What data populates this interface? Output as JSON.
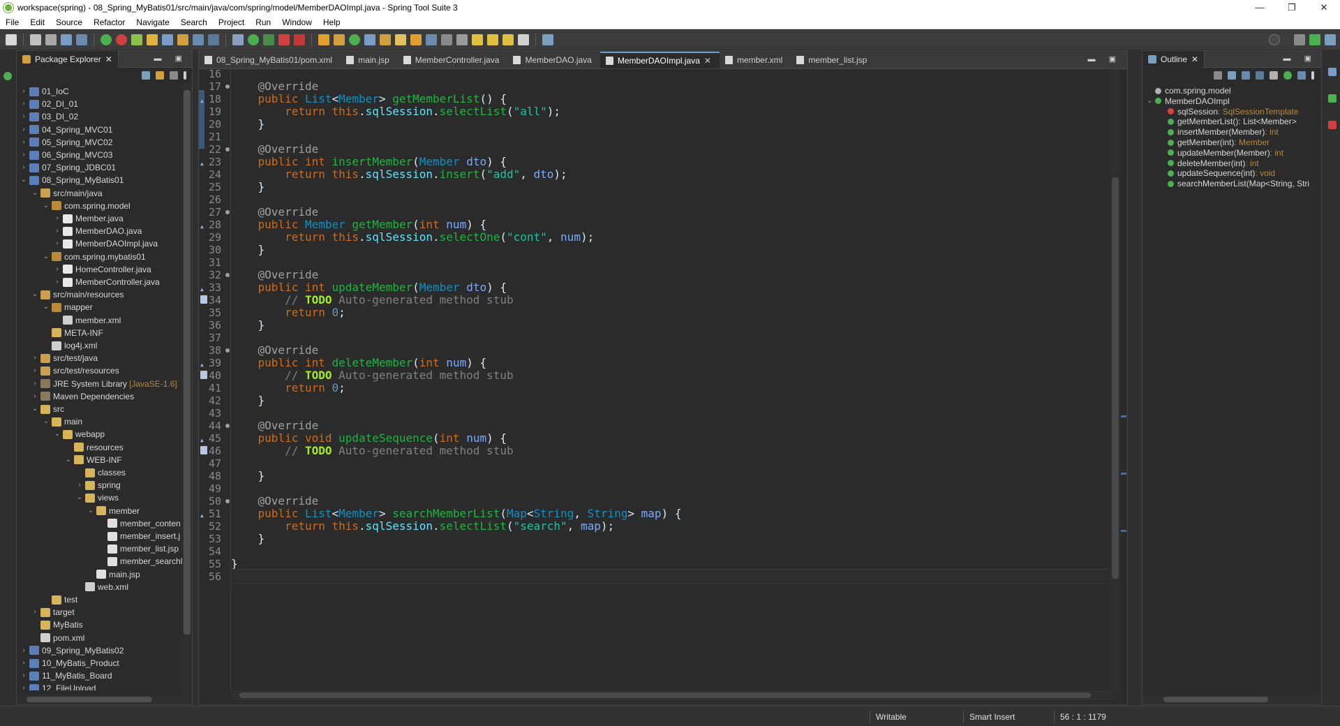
{
  "window": {
    "title": "workspace(spring) - 08_Spring_MyBatis01/src/main/java/com/spring/model/MemberDAOImpl.java - Spring Tool Suite 3",
    "controls": [
      "—",
      "❐",
      "✕"
    ]
  },
  "menu": [
    "File",
    "Edit",
    "Source",
    "Refactor",
    "Navigate",
    "Search",
    "Project",
    "Run",
    "Window",
    "Help"
  ],
  "package_explorer": {
    "title": "Package Explorer",
    "close": "✕",
    "tree": [
      {
        "label": "01_IoC",
        "depth": 0,
        "icon": "proj",
        "arrow": "›"
      },
      {
        "label": "02_DI_01",
        "depth": 0,
        "icon": "proj",
        "arrow": "›"
      },
      {
        "label": "03_DI_02",
        "depth": 0,
        "icon": "proj",
        "arrow": "›"
      },
      {
        "label": "04_Spring_MVC01",
        "depth": 0,
        "icon": "proj",
        "arrow": "›"
      },
      {
        "label": "05_Spring_MVC02",
        "depth": 0,
        "icon": "proj",
        "arrow": "›"
      },
      {
        "label": "06_Spring_MVC03",
        "depth": 0,
        "icon": "proj",
        "arrow": "›"
      },
      {
        "label": "07_Spring_JDBC01",
        "depth": 0,
        "icon": "proj",
        "arrow": "›"
      },
      {
        "label": "08_Spring_MyBatis01",
        "depth": 0,
        "icon": "proj",
        "arrow": "⌄"
      },
      {
        "label": "src/main/java",
        "depth": 1,
        "icon": "src",
        "arrow": "⌄"
      },
      {
        "label": "com.spring.model",
        "depth": 2,
        "icon": "pkg",
        "arrow": "⌄"
      },
      {
        "label": "Member.java",
        "depth": 3,
        "icon": "java",
        "arrow": "›"
      },
      {
        "label": "MemberDAO.java",
        "depth": 3,
        "icon": "java",
        "arrow": "›"
      },
      {
        "label": "MemberDAOImpl.java",
        "depth": 3,
        "icon": "java",
        "arrow": "›"
      },
      {
        "label": "com.spring.mybatis01",
        "depth": 2,
        "icon": "pkg",
        "arrow": "⌄"
      },
      {
        "label": "HomeController.java",
        "depth": 3,
        "icon": "java",
        "arrow": "›"
      },
      {
        "label": "MemberController.java",
        "depth": 3,
        "icon": "java",
        "arrow": "›"
      },
      {
        "label": "src/main/resources",
        "depth": 1,
        "icon": "src",
        "arrow": "⌄"
      },
      {
        "label": "mapper",
        "depth": 2,
        "icon": "pkg",
        "arrow": "⌄"
      },
      {
        "label": "member.xml",
        "depth": 3,
        "icon": "xml",
        "arrow": ""
      },
      {
        "label": "META-INF",
        "depth": 2,
        "icon": "fold",
        "arrow": ""
      },
      {
        "label": "log4j.xml",
        "depth": 2,
        "icon": "xml",
        "arrow": ""
      },
      {
        "label": "src/test/java",
        "depth": 1,
        "icon": "src",
        "arrow": "›"
      },
      {
        "label": "src/test/resources",
        "depth": 1,
        "icon": "src",
        "arrow": "›"
      },
      {
        "label": "JRE System Library",
        "decor": "[JavaSE-1.6]",
        "depth": 1,
        "icon": "jar",
        "arrow": "›"
      },
      {
        "label": "Maven Dependencies",
        "depth": 1,
        "icon": "jar",
        "arrow": "›"
      },
      {
        "label": "src",
        "depth": 1,
        "icon": "fold",
        "arrow": "⌄"
      },
      {
        "label": "main",
        "depth": 2,
        "icon": "fold",
        "arrow": "⌄"
      },
      {
        "label": "webapp",
        "depth": 3,
        "icon": "fold",
        "arrow": "⌄"
      },
      {
        "label": "resources",
        "depth": 4,
        "icon": "fold",
        "arrow": ""
      },
      {
        "label": "WEB-INF",
        "depth": 4,
        "icon": "fold",
        "arrow": "⌄"
      },
      {
        "label": "classes",
        "depth": 5,
        "icon": "fold",
        "arrow": ""
      },
      {
        "label": "spring",
        "depth": 5,
        "icon": "fold",
        "arrow": "›"
      },
      {
        "label": "views",
        "depth": 5,
        "icon": "fold",
        "arrow": "⌄"
      },
      {
        "label": "member",
        "depth": 6,
        "icon": "fold",
        "arrow": "⌄"
      },
      {
        "label": "member_conten",
        "depth": 7,
        "icon": "jsp",
        "arrow": ""
      },
      {
        "label": "member_insert.j",
        "depth": 7,
        "icon": "jsp",
        "arrow": ""
      },
      {
        "label": "member_list.jsp",
        "depth": 7,
        "icon": "jsp",
        "arrow": ""
      },
      {
        "label": "member_searchl",
        "depth": 7,
        "icon": "jsp",
        "arrow": ""
      },
      {
        "label": "main.jsp",
        "depth": 6,
        "icon": "jsp",
        "arrow": ""
      },
      {
        "label": "web.xml",
        "depth": 5,
        "icon": "xml",
        "arrow": ""
      },
      {
        "label": "test",
        "depth": 2,
        "icon": "fold",
        "arrow": ""
      },
      {
        "label": "target",
        "depth": 1,
        "icon": "fold",
        "arrow": "›"
      },
      {
        "label": "MyBatis",
        "depth": 1,
        "icon": "fold",
        "arrow": ""
      },
      {
        "label": "pom.xml",
        "depth": 1,
        "icon": "xml",
        "arrow": ""
      },
      {
        "label": "09_Spring_MyBatis02",
        "depth": 0,
        "icon": "proj",
        "arrow": "›"
      },
      {
        "label": "10_MyBatis_Product",
        "depth": 0,
        "icon": "proj",
        "arrow": "›"
      },
      {
        "label": "11_MyBatis_Board",
        "depth": 0,
        "icon": "proj",
        "arrow": "›"
      },
      {
        "label": "12_FileUpload",
        "depth": 0,
        "icon": "proj",
        "arrow": "›"
      },
      {
        "label": "13_AOP",
        "depth": 0,
        "icon": "proj",
        "arrow": "›"
      }
    ]
  },
  "editor": {
    "tabs": [
      {
        "label": "08_Spring_MyBatis01/pom.xml",
        "active": false
      },
      {
        "label": "main.jsp",
        "active": false
      },
      {
        "label": "MemberController.java",
        "active": false
      },
      {
        "label": "MemberDAO.java",
        "active": false
      },
      {
        "label": "MemberDAOImpl.java",
        "active": true,
        "close": "✕"
      },
      {
        "label": "member.xml",
        "active": false
      },
      {
        "label": "member_list.jsp",
        "active": false
      }
    ],
    "lines": [
      {
        "n": "16",
        "html": ""
      },
      {
        "n": "17",
        "mark": true,
        "html": "    <span class=\"a\">@Override</span>"
      },
      {
        "n": "18",
        "ovr": true,
        "html": "    <span class=\"k\">public</span> <span class=\"t\">List</span>&lt;<span class=\"t\">Member</span>&gt; <span class=\"m\">getMemberList</span>() {"
      },
      {
        "n": "19",
        "html": "        <span class=\"k\">return</span> <span class=\"k\">this</span>.<span class=\"f\">sqlSession</span>.<span class=\"m\">selectList</span>(<span class=\"s\">\"all\"</span>);"
      },
      {
        "n": "20",
        "html": "    }"
      },
      {
        "n": "21",
        "html": ""
      },
      {
        "n": "22",
        "mark": true,
        "html": "    <span class=\"a\">@Override</span>"
      },
      {
        "n": "23",
        "ovr": true,
        "html": "    <span class=\"k\">public</span> <span class=\"k\">int</span> <span class=\"m\">insertMember</span>(<span class=\"t\">Member</span> <span class=\"p\">dto</span>) {"
      },
      {
        "n": "24",
        "html": "        <span class=\"k\">return</span> <span class=\"k\">this</span>.<span class=\"f\">sqlSession</span>.<span class=\"m\">insert</span>(<span class=\"s\">\"add\"</span>, <span class=\"p\">dto</span>);"
      },
      {
        "n": "25",
        "html": "    }"
      },
      {
        "n": "26",
        "html": ""
      },
      {
        "n": "27",
        "mark": true,
        "html": "    <span class=\"a\">@Override</span>"
      },
      {
        "n": "28",
        "ovr": true,
        "html": "    <span class=\"k\">public</span> <span class=\"t\">Member</span> <span class=\"m\">getMember</span>(<span class=\"k\">int</span> <span class=\"p\">num</span>) {"
      },
      {
        "n": "29",
        "html": "        <span class=\"k\">return</span> <span class=\"k\">this</span>.<span class=\"f\">sqlSession</span>.<span class=\"m\">selectOne</span>(<span class=\"s\">\"cont\"</span>, <span class=\"p\">num</span>);"
      },
      {
        "n": "30",
        "html": "    }"
      },
      {
        "n": "31",
        "html": ""
      },
      {
        "n": "32",
        "mark": true,
        "html": "    <span class=\"a\">@Override</span>"
      },
      {
        "n": "33",
        "ovr": true,
        "html": "    <span class=\"k\">public</span> <span class=\"k\">int</span> <span class=\"m\">updateMember</span>(<span class=\"t\">Member</span> <span class=\"p\">dto</span>) {"
      },
      {
        "n": "34",
        "task": true,
        "html": "        <span class=\"c\">// <span class=\"todo\">TODO</span> Auto-generated method stub</span>"
      },
      {
        "n": "35",
        "html": "        <span class=\"k\">return</span> <span class=\"n\">0</span>;"
      },
      {
        "n": "36",
        "html": "    }"
      },
      {
        "n": "37",
        "html": ""
      },
      {
        "n": "38",
        "mark": true,
        "html": "    <span class=\"a\">@Override</span>"
      },
      {
        "n": "39",
        "ovr": true,
        "html": "    <span class=\"k\">public</span> <span class=\"k\">int</span> <span class=\"m\">deleteMember</span>(<span class=\"k\">int</span> <span class=\"p\">num</span>) {"
      },
      {
        "n": "40",
        "task": true,
        "html": "        <span class=\"c\">// <span class=\"todo\">TODO</span> Auto-generated method stub</span>"
      },
      {
        "n": "41",
        "html": "        <span class=\"k\">return</span> <span class=\"n\">0</span>;"
      },
      {
        "n": "42",
        "html": "    }"
      },
      {
        "n": "43",
        "html": ""
      },
      {
        "n": "44",
        "mark": true,
        "html": "    <span class=\"a\">@Override</span>"
      },
      {
        "n": "45",
        "ovr": true,
        "html": "    <span class=\"k\">public</span> <span class=\"k\">void</span> <span class=\"m\">updateSequence</span>(<span class=\"k\">int</span> <span class=\"p\">num</span>) {"
      },
      {
        "n": "46",
        "task": true,
        "html": "        <span class=\"c\">// <span class=\"todo\">TODO</span> Auto-generated method stub</span>"
      },
      {
        "n": "47",
        "html": ""
      },
      {
        "n": "48",
        "html": "    }"
      },
      {
        "n": "49",
        "html": ""
      },
      {
        "n": "50",
        "mark": true,
        "html": "    <span class=\"a\">@Override</span>"
      },
      {
        "n": "51",
        "ovr": true,
        "html": "    <span class=\"k\">public</span> <span class=\"t\">List</span>&lt;<span class=\"t\">Member</span>&gt; <span class=\"m\">searchMemberList</span>(<span class=\"t\">Map</span>&lt;<span class=\"t\">String</span>, <span class=\"t\">String</span>&gt; <span class=\"p\">map</span>) {"
      },
      {
        "n": "52",
        "html": "        <span class=\"k\">return</span> <span class=\"k\">this</span>.<span class=\"f\">sqlSession</span>.<span class=\"m\">selectList</span>(<span class=\"s\">\"search\"</span>, <span class=\"p\">map</span>);"
      },
      {
        "n": "53",
        "html": "    }"
      },
      {
        "n": "54",
        "html": ""
      },
      {
        "n": "55",
        "html": "}"
      },
      {
        "n": "56",
        "cur": true,
        "html": ""
      }
    ]
  },
  "outline": {
    "title": "Outline",
    "close": "✕",
    "items": [
      {
        "label": "com.spring.model",
        "ret": "",
        "depth": 0,
        "icon": "#b0b0b0",
        "arrow": ""
      },
      {
        "label": "MemberDAOImpl",
        "ret": "",
        "depth": 0,
        "icon": "#4caf50",
        "arrow": "⌄"
      },
      {
        "label": "sqlSession",
        "ret": " : SqlSessionTemplate",
        "depth": 1,
        "icon": "#e04040",
        "arrow": ""
      },
      {
        "label": "getMemberList()",
        "ret": " : List<Member>",
        "depth": 1,
        "icon": "#4caf50",
        "arrow": "",
        "retwhite": true
      },
      {
        "label": "insertMember(Member)",
        "ret": " : int",
        "depth": 1,
        "icon": "#4caf50",
        "arrow": ""
      },
      {
        "label": "getMember(int)",
        "ret": " : Member",
        "depth": 1,
        "icon": "#4caf50",
        "arrow": ""
      },
      {
        "label": "updateMember(Member)",
        "ret": " : int",
        "depth": 1,
        "icon": "#4caf50",
        "arrow": ""
      },
      {
        "label": "deleteMember(int)",
        "ret": " : int",
        "depth": 1,
        "icon": "#4caf50",
        "arrow": ""
      },
      {
        "label": "updateSequence(int)",
        "ret": " : void",
        "depth": 1,
        "icon": "#4caf50",
        "arrow": ""
      },
      {
        "label": "searchMemberList(Map<String, Stri",
        "ret": "",
        "depth": 1,
        "icon": "#4caf50",
        "arrow": ""
      }
    ]
  },
  "status": {
    "writable": "Writable",
    "insert_mode": "Smart Insert",
    "position": "56 : 1 : 1179"
  },
  "colors": {
    "background": "#2b2b2b",
    "keyword": "#cc6c1d",
    "method": "#1eb540",
    "string": "#17c6a3",
    "type": "#1290c3"
  }
}
